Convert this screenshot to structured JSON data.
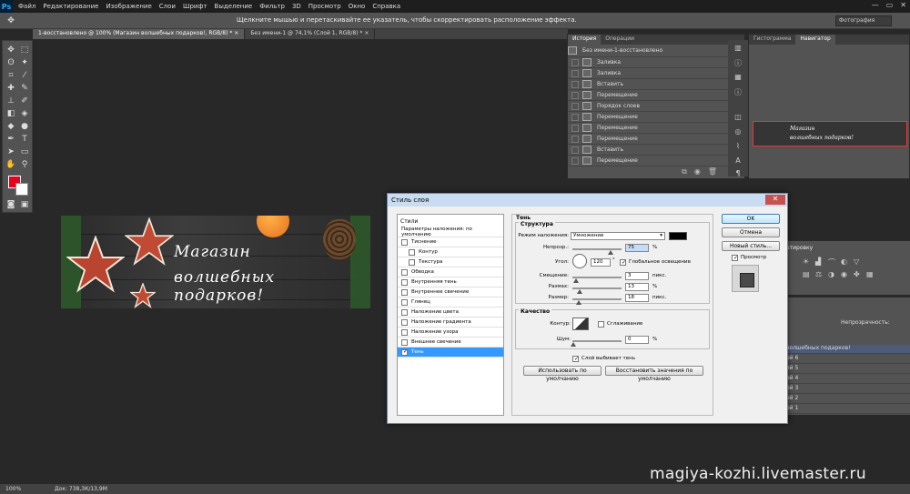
{
  "app": {
    "logo": "Ps",
    "menu": [
      "Файл",
      "Редактирование",
      "Изображение",
      "Слои",
      "Шрифт",
      "Выделение",
      "Фильтр",
      "3D",
      "Просмотр",
      "Окно",
      "Справка"
    ],
    "window_controls": [
      "—",
      "▭",
      "✕"
    ]
  },
  "options_bar": {
    "hint": "Щелкните мышью и перетаскивайте ее указатель, чтобы скорректировать расположение эффекта.",
    "workspace": "Фотография"
  },
  "doc_tabs": [
    {
      "label": "1-восстановлено @ 100% (Магазин  волшебных подарков!, RGB/8) *  ×"
    },
    {
      "label": "Без имени-1 @ 74,1% (Слой 1, RGB/8) *  ×"
    }
  ],
  "colors": {
    "foreground": "#e8001c",
    "background": "#ffffff"
  },
  "canvas": {
    "title_line1": "Магазин",
    "title_line2": "волшебных подарков!"
  },
  "history_panel": {
    "tabs": [
      "История",
      "Операции"
    ],
    "snapshot": "Без имени-1-восстановлено",
    "items": [
      "Заливка",
      "Заливка",
      "Вставить",
      "Перемещение",
      "Порядок слоев",
      "Перемещение",
      "Перемещение",
      "Перемещение",
      "Вставить",
      "Перемещение"
    ]
  },
  "navigator_panel": {
    "tabs": [
      "Гистограмма",
      "Навигатор"
    ],
    "thumb_line1": "Магазин",
    "thumb_line2": "волшебных подарков!"
  },
  "corrections_panel": {
    "title": "ктировку"
  },
  "layers_panel": {
    "opacity_label": "Непрозрачность:",
    "rows": [
      "волшебных подарков!",
      "ой 6",
      "ой 5",
      "ой 4",
      "ой 3",
      "ой 2",
      "ой 1"
    ]
  },
  "status": {
    "zoom": "100%",
    "doc": "Док: 738,3К/13,9М"
  },
  "watermark": "magiya-kozhi.livemaster.ru",
  "dialog": {
    "title": "Стиль слоя",
    "close": "✕",
    "styles_header": "Стили",
    "blending_options": "Параметры наложения: по умолчанию",
    "style_items": [
      {
        "label": "Тиснение",
        "checked": false,
        "indent": false
      },
      {
        "label": "Контур",
        "checked": false,
        "indent": true
      },
      {
        "label": "Текстура",
        "checked": false,
        "indent": true
      },
      {
        "label": "Обводка",
        "checked": false,
        "indent": false
      },
      {
        "label": "Внутренняя тень",
        "checked": false,
        "indent": false
      },
      {
        "label": "Внутреннее свечение",
        "checked": false,
        "indent": false
      },
      {
        "label": "Глянец",
        "checked": false,
        "indent": false
      },
      {
        "label": "Наложение цвета",
        "checked": false,
        "indent": false
      },
      {
        "label": "Наложение градиента",
        "checked": false,
        "indent": false
      },
      {
        "label": "Наложение узора",
        "checked": false,
        "indent": false
      },
      {
        "label": "Внешнее свечение",
        "checked": false,
        "indent": false
      },
      {
        "label": "Тень",
        "checked": true,
        "indent": false
      }
    ],
    "section_title": "Тень",
    "structure_title": "Структура",
    "blend_mode_label": "Режим наложения:",
    "blend_mode_value": "Умножение",
    "opacity_label": "Непрозр.:",
    "opacity_value": "75",
    "angle_label": "Угол:",
    "angle_value": "120",
    "degree": "°",
    "global_light": "Глобальное освещение",
    "distance_label": "Смещение:",
    "distance_value": "3",
    "spread_label": "Размах:",
    "spread_value": "13",
    "size_label": "Размер:",
    "size_value": "18",
    "unit_px": "пикс.",
    "unit_pct": "%",
    "quality_title": "Качество",
    "contour_label": "Контур:",
    "antialias": "Сглаживание",
    "noise_label": "Шум:",
    "noise_value": "0",
    "knockout": "Слой выбивает тень",
    "use_default": "Использовать по умолчанию",
    "reset_default": "Восстановить значения по умолчанию",
    "ok": "OK",
    "cancel": "Отмена",
    "new_style": "Новый стиль...",
    "preview": "Просмотр"
  }
}
